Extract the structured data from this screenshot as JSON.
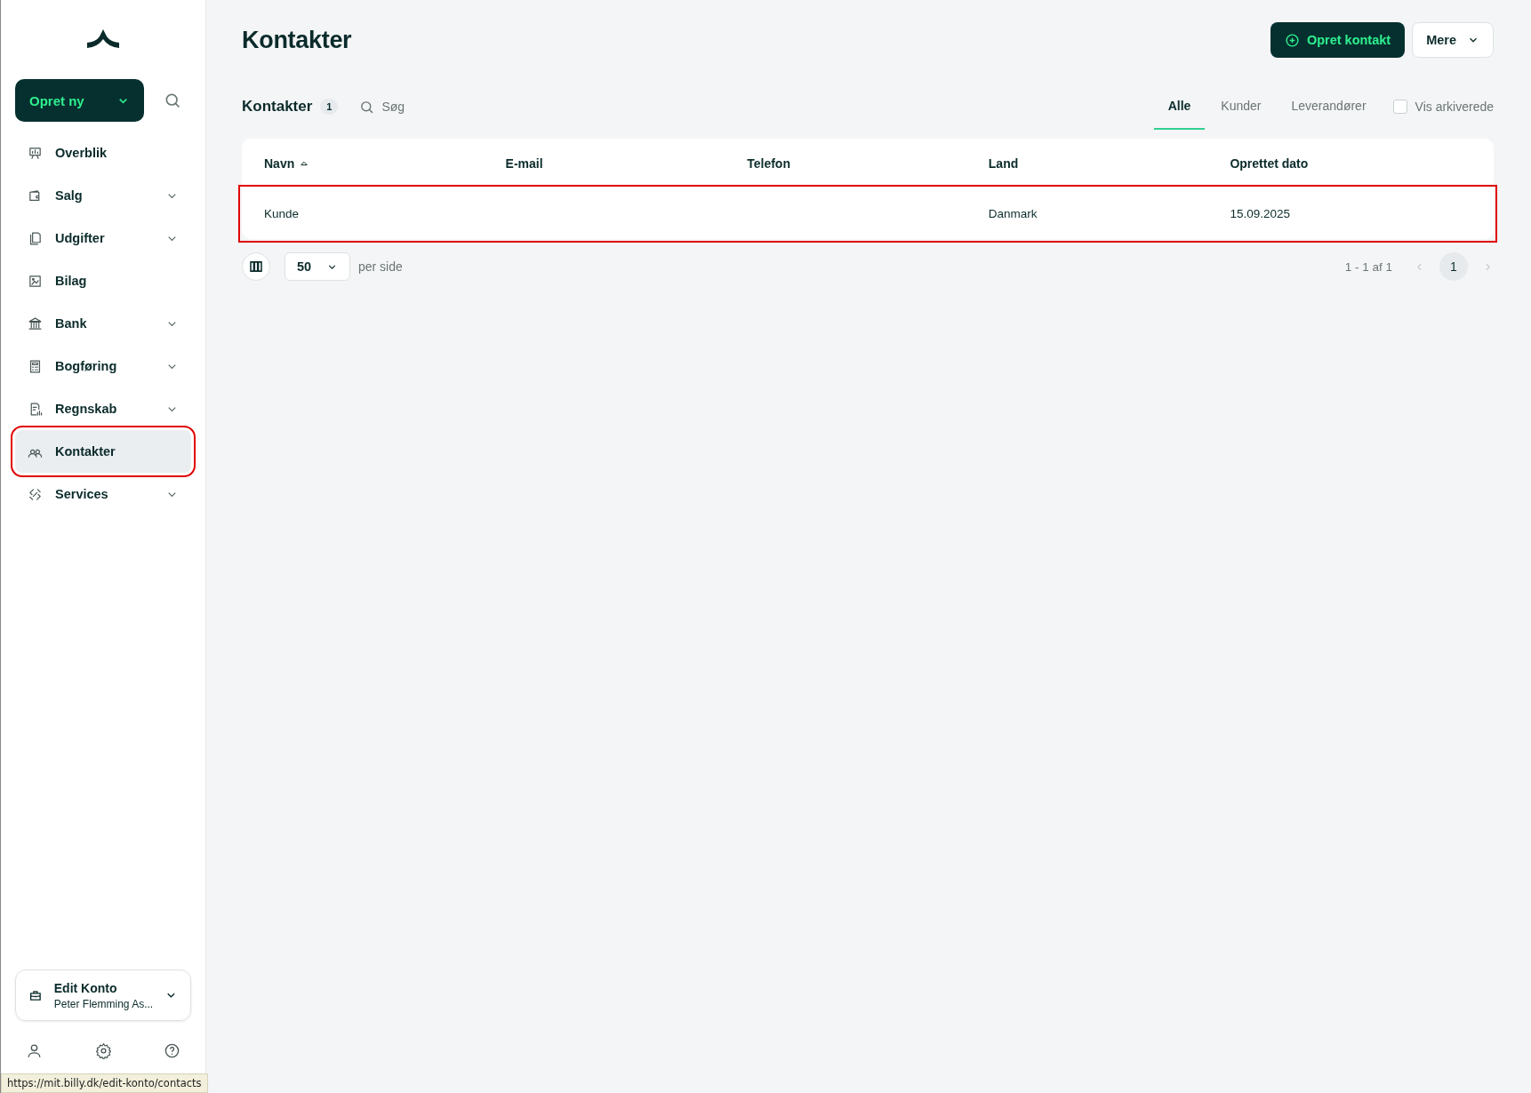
{
  "sidebar": {
    "create_button": {
      "label": "Opret ny"
    },
    "nav_items": [
      {
        "label": "Overblik",
        "expandable": false,
        "selected": false,
        "highlighted": false
      },
      {
        "label": "Salg",
        "expandable": true,
        "selected": false,
        "highlighted": false
      },
      {
        "label": "Udgifter",
        "expandable": true,
        "selected": false,
        "highlighted": false
      },
      {
        "label": "Bilag",
        "expandable": false,
        "selected": false,
        "highlighted": false
      },
      {
        "label": "Bank",
        "expandable": true,
        "selected": false,
        "highlighted": false
      },
      {
        "label": "Bogføring",
        "expandable": true,
        "selected": false,
        "highlighted": false
      },
      {
        "label": "Regnskab",
        "expandable": true,
        "selected": false,
        "highlighted": false
      },
      {
        "label": "Kontakter",
        "expandable": false,
        "selected": true,
        "highlighted": true
      },
      {
        "label": "Services",
        "expandable": true,
        "selected": false,
        "highlighted": false
      }
    ],
    "account": {
      "name": "Edit Konto",
      "subtitle": "Peter Flemming As..."
    }
  },
  "status_url": "https://mit.billy.dk/edit-konto/contacts",
  "page": {
    "title": "Kontakter",
    "primary_button": "Opret kontakt",
    "more_button": "Mere"
  },
  "list": {
    "title": "Kontakter",
    "count": "1",
    "search_placeholder": "Søg",
    "tabs": [
      {
        "label": "Alle",
        "selected": true
      },
      {
        "label": "Kunder",
        "selected": false
      },
      {
        "label": "Leverandører",
        "selected": false
      }
    ],
    "archived_checkbox": {
      "label": "Vis arkiverede",
      "checked": false
    }
  },
  "table": {
    "columns": [
      {
        "label": "Navn",
        "sorted": true
      },
      {
        "label": "E-mail",
        "sorted": false
      },
      {
        "label": "Telefon",
        "sorted": false
      },
      {
        "label": "Land",
        "sorted": false
      },
      {
        "label": "Oprettet dato",
        "sorted": false
      }
    ],
    "rows": [
      {
        "cells": [
          "Kunde",
          "",
          "",
          "Danmark",
          "15.09.2025"
        ],
        "highlighted": true
      }
    ]
  },
  "pagination": {
    "page_size": "50",
    "per_page_label": "per side",
    "range": "1 - 1 af 1",
    "pages": [
      {
        "label": "1",
        "selected": true
      }
    ]
  }
}
